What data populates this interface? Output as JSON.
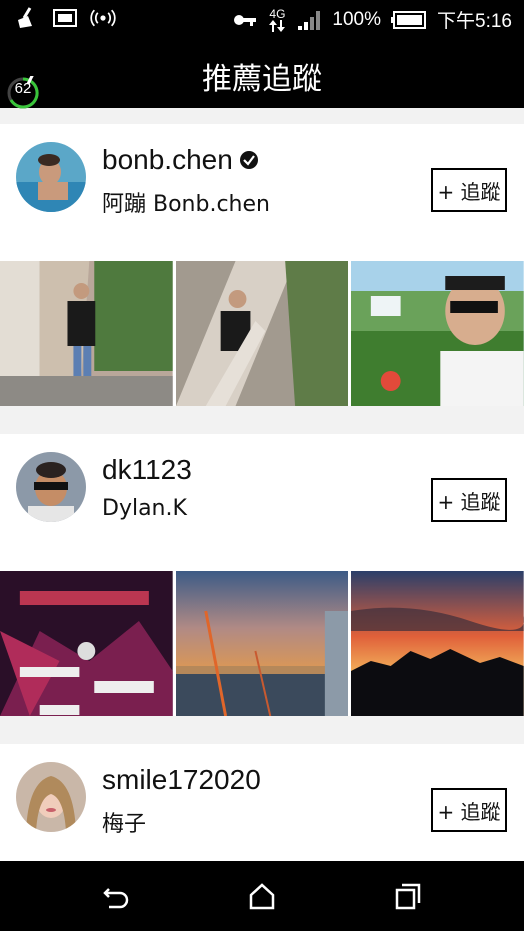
{
  "status_bar": {
    "battery": "100%",
    "time": "下午5:16",
    "network": "4G",
    "icons": [
      "broom-icon",
      "image-icon",
      "wireless-signal-icon",
      "key-icon",
      "data-transfer-icon",
      "signal-bars-icon",
      "battery-icon"
    ]
  },
  "app_bar": {
    "title": "推薦追蹤",
    "boost_value": "62"
  },
  "suggestions": [
    {
      "username": "bonb.chen",
      "display_name": "阿蹦 Bonb.chen",
      "verified": true,
      "follow_label": "+ 追蹤"
    },
    {
      "username": "dk1123",
      "display_name": "Dylan.K",
      "verified": false,
      "follow_label": "+ 追蹤"
    },
    {
      "username": "smile172020",
      "display_name": "梅子",
      "verified": false,
      "follow_label": "+ 追蹤"
    }
  ],
  "nav": {
    "back": "back-icon",
    "home": "home-icon",
    "recents": "recents-icon"
  }
}
